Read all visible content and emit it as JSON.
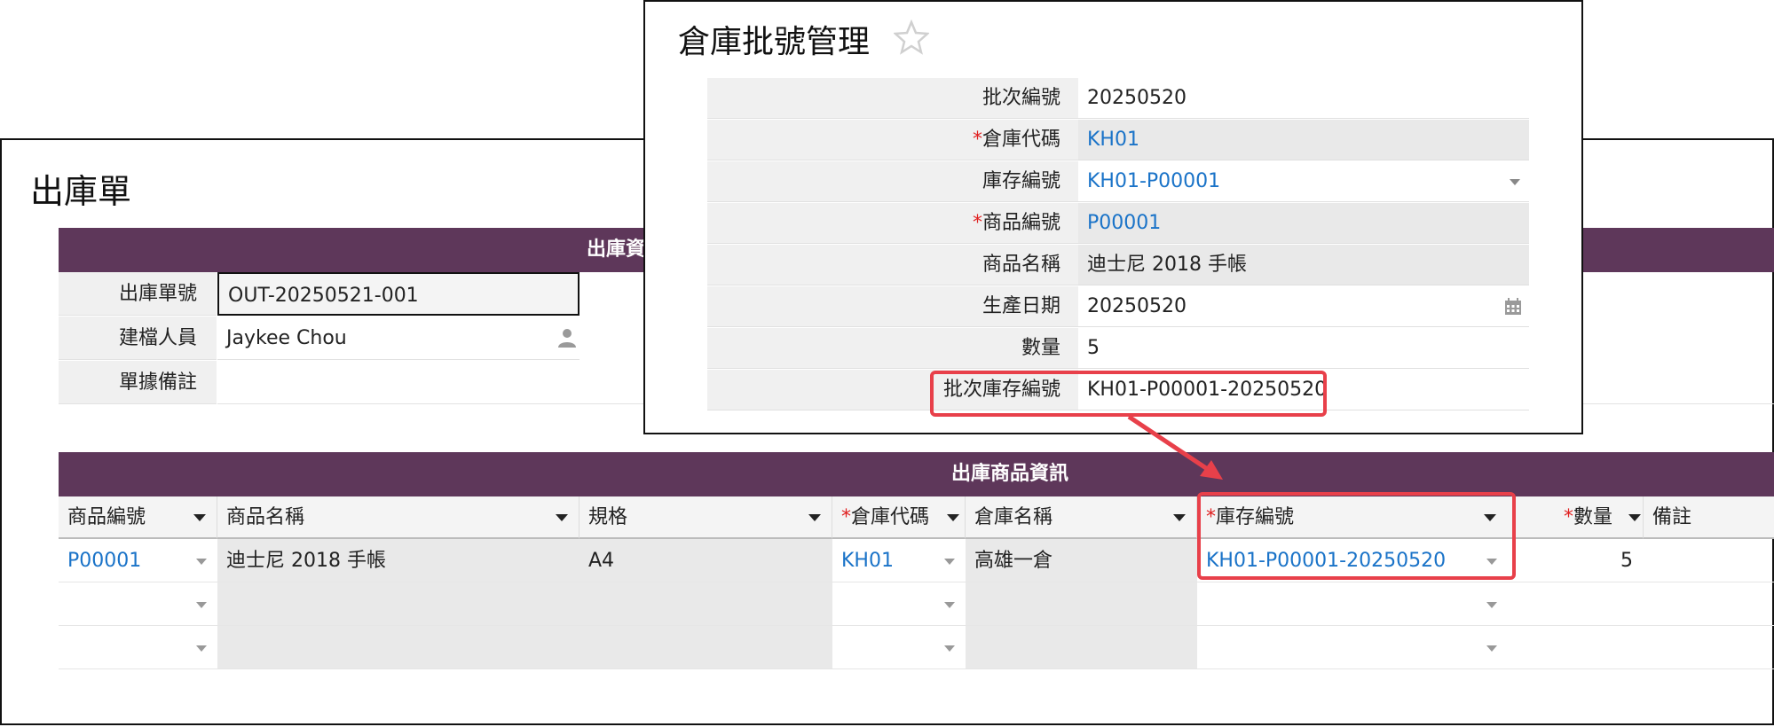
{
  "outbound_form": {
    "title": "出庫單",
    "section_title": "出庫資",
    "fields": [
      {
        "label": "出庫單號",
        "value": "OUT-20250521-001"
      },
      {
        "label": "建檔人員",
        "value": "Jaykee Chou"
      },
      {
        "label": "單據備註",
        "value": ""
      }
    ],
    "grid": {
      "title": "出庫商品資訊",
      "columns": [
        {
          "label": "商品編號",
          "required": false
        },
        {
          "label": "商品名稱",
          "required": false
        },
        {
          "label": "規格",
          "required": false
        },
        {
          "label": "倉庫代碼",
          "required": true
        },
        {
          "label": "倉庫名稱",
          "required": false
        },
        {
          "label": "庫存編號",
          "required": true
        },
        {
          "label": "數量",
          "required": true
        },
        {
          "label": "備註",
          "required": false
        }
      ],
      "rows": [
        {
          "product_id": "P00001",
          "product_name": "迪士尼 2018 手帳",
          "spec": "A4",
          "warehouse_code": "KH01",
          "warehouse_name": "高雄一倉",
          "stock_id": "KH01-P00001-20250520",
          "qty": "5",
          "note": ""
        },
        {
          "product_id": "",
          "product_name": "",
          "spec": "",
          "warehouse_code": "",
          "warehouse_name": "",
          "stock_id": "",
          "qty": "",
          "note": ""
        },
        {
          "product_id": "",
          "product_name": "",
          "spec": "",
          "warehouse_code": "",
          "warehouse_name": "",
          "stock_id": "",
          "qty": "",
          "note": ""
        }
      ]
    }
  },
  "batch_popup": {
    "title": "倉庫批號管理",
    "star_icon": "star-outline-icon",
    "fields": [
      {
        "label": "批次編號",
        "value": "20250520",
        "required": false
      },
      {
        "label": "倉庫代碼",
        "value": "KH01",
        "required": true
      },
      {
        "label": "庫存編號",
        "value": "KH01-P00001",
        "required": false
      },
      {
        "label": "商品編號",
        "value": "P00001",
        "required": true
      },
      {
        "label": "商品名稱",
        "value": "迪士尼 2018 手帳",
        "required": false
      },
      {
        "label": "生產日期",
        "value": "20250520",
        "required": false
      },
      {
        "label": "數量",
        "value": "5",
        "required": false
      },
      {
        "label": "批次庫存編號",
        "value": "KH01-P00001-20250520",
        "required": false
      }
    ]
  },
  "colors": {
    "header_bar": "#5e375a",
    "link": "#1a73c8",
    "highlight": "#e8404a",
    "required_mark": "#e02020"
  },
  "icons": [
    "person-icon",
    "calendar-icon",
    "star-outline-icon",
    "dropdown-arrow-icon"
  ]
}
